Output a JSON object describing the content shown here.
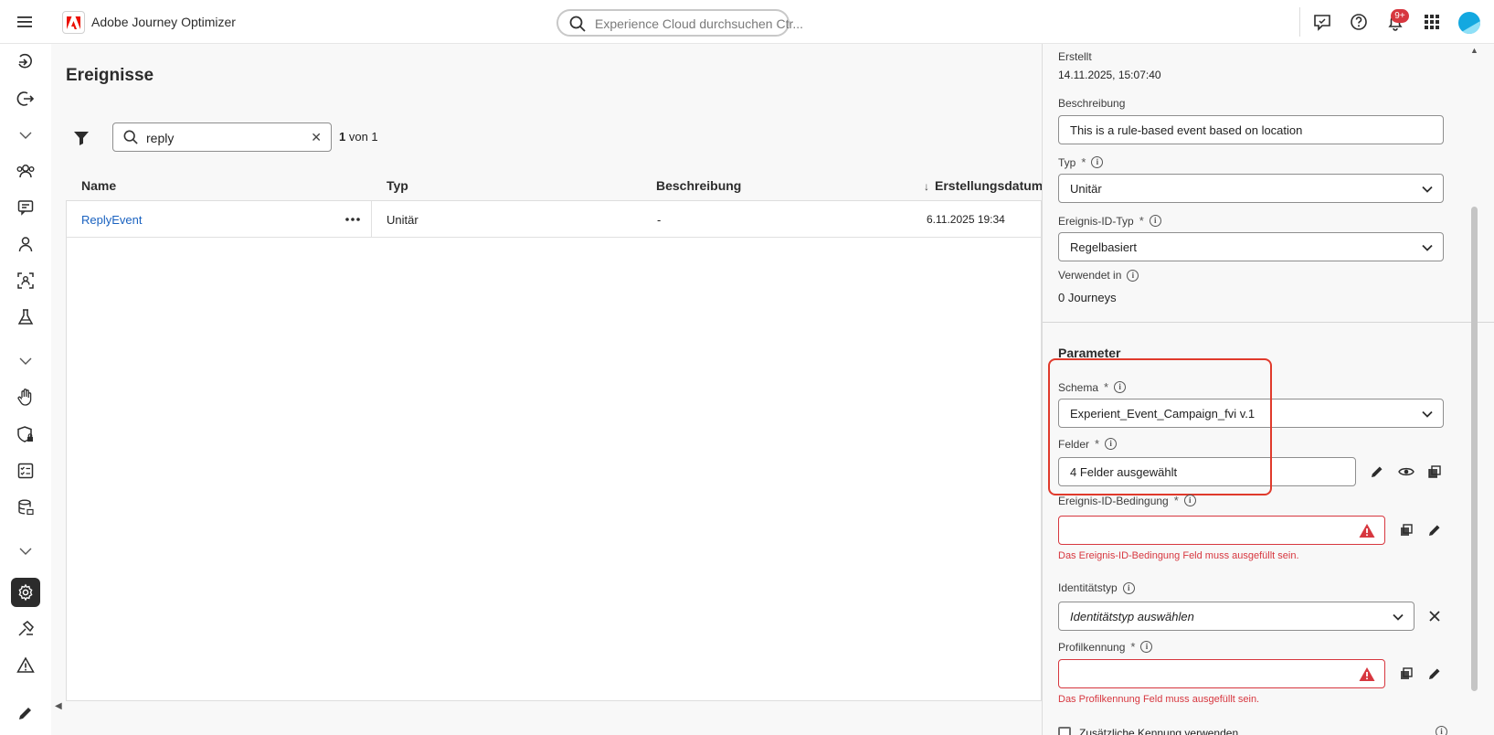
{
  "app": {
    "title": "Adobe Journey Optimizer",
    "search_placeholder": "Experience Cloud durchsuchen Ctr...",
    "notification_count": "9+",
    "brand_color": "#eb1000",
    "error_color": "#d7373f",
    "link_color": "#1a62c0"
  },
  "left_rail": {
    "icons": [
      "arrow-in-icon",
      "logout-icon",
      "chevron-down-icon",
      "audience-icon",
      "message-icon",
      "profile-icon",
      "identity-scan-icon",
      "flask-icon",
      "chevron-down-icon",
      "hand-icon",
      "shield-lock-icon",
      "checklist-icon",
      "database-icon",
      "chevron-down-icon",
      "gear-icon",
      "hammer-icon",
      "alert-icon",
      "pencil-icon"
    ],
    "active": "gear-icon"
  },
  "main": {
    "title": "Ereignisse",
    "search_value": "reply",
    "count_value": "1",
    "count_suffix": "von 1",
    "columns": [
      "Name",
      "Typ",
      "Beschreibung",
      "Erstellungsdatum"
    ],
    "rows": [
      {
        "name": "ReplyEvent",
        "typ": "Unitär",
        "beschreibung": "-",
        "datum": "6.11.2025 19:34"
      }
    ]
  },
  "panel": {
    "created_label": "Erstellt",
    "created_value": "14.11.2025, 15:07:40",
    "description_label": "Beschreibung",
    "description_value": "This is a rule-based event based on location",
    "type_label": "Typ",
    "type_value": "Unitär",
    "id_type_label": "Ereignis-ID-Typ",
    "id_type_value": "Regelbasiert",
    "used_in_label": "Verwendet in",
    "used_in_value": "0 Journeys",
    "params_title": "Parameter",
    "schema_label": "Schema",
    "schema_value": "Experient_Event_Campaign_fvi v.1",
    "fields_label": "Felder",
    "fields_value": "4 Felder ausgewählt",
    "id_condition_label": "Ereignis-ID-Bedingung",
    "id_condition_value": "",
    "id_condition_error": "Das Ereignis-ID-Bedingung Feld muss ausgefüllt sein.",
    "identity_type_label": "Identitätstyp",
    "identity_type_placeholder": "Identitätstyp auswählen",
    "profile_id_label": "Profilkennung",
    "profile_id_value": "",
    "profile_id_error": "Das Profilkennung Feld muss ausgefüllt sein.",
    "extra_id_label": "Zusätzliche Kennung verwenden",
    "required_mark": "*",
    "info_mark": "i"
  }
}
